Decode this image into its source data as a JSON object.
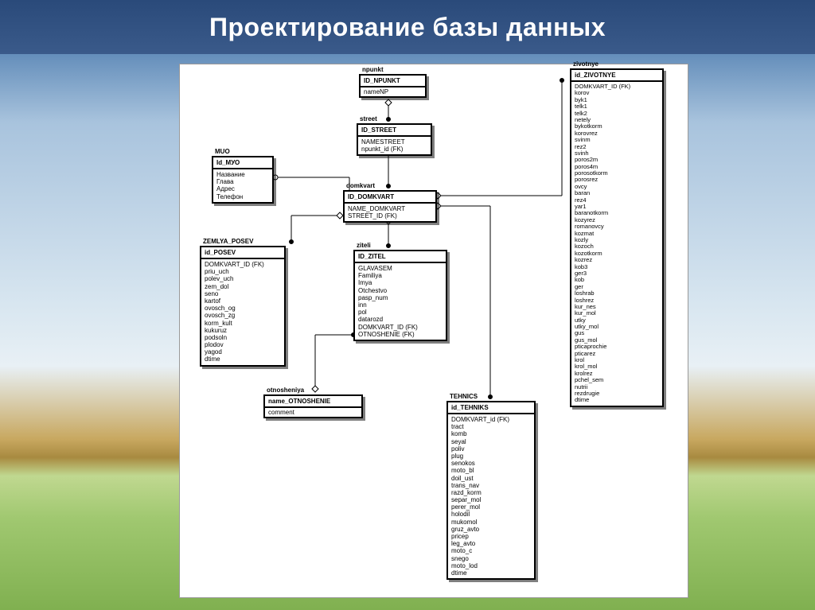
{
  "title": "Проектирование базы данных",
  "entities": {
    "npunkt": {
      "name": "npunkt",
      "key": "ID_NPUNKT",
      "attrs": [
        "nameNP"
      ]
    },
    "street": {
      "name": "street",
      "key": "ID_STREET",
      "attrs": [
        "NAMESTREET",
        "npunkt_id (FK)"
      ]
    },
    "muo": {
      "name": "MUO",
      "key": "Id_МУО",
      "attrs": [
        "Название",
        "Глава",
        "Адрес",
        "Телефон"
      ]
    },
    "domkvart": {
      "name": "domkvart",
      "key": "ID_DOMKVART",
      "attrs": [
        "NAME_DOMKVART",
        "STREET_ID (FK)"
      ]
    },
    "zemlya_posev": {
      "name": "ZEMLYA_POSEV",
      "key": "id_POSEV",
      "attrs": [
        "DOMKVART_ID (FK)",
        "priu_uch",
        "polev_uch",
        "zem_dol",
        "seno",
        "kartof",
        "ovosch_og",
        "ovosch_zg",
        "korm_kult",
        "kukuruz",
        "podsoln",
        "plodov",
        "yagod",
        "dtime"
      ]
    },
    "ziteli": {
      "name": "ziteli",
      "key": "ID_ZITEL",
      "attrs": [
        "GLAVASEM",
        "Familiya",
        "Imya",
        "Otchestvo",
        "pasp_num",
        "inn",
        "pol",
        "datarozd",
        "DOMKVART_ID (FK)",
        "OTNOSHENIE (FK)"
      ]
    },
    "otnosheniya": {
      "name": "otnosheniya",
      "key": "name_OTNOSHENIE",
      "attrs": [
        "comment"
      ]
    },
    "tehnics": {
      "name": "TEHNICS",
      "key": "id_TEHNIKS",
      "attrs": [
        "DOMKVART_id (FK)",
        "tract",
        "komb",
        "seyal",
        "poliv",
        "plug",
        "senokos",
        "moto_bl",
        "doil_ust",
        "trans_nav",
        "razd_korm",
        "separ_mol",
        "perer_mol",
        "holodil",
        "mukomol",
        "gruz_avto",
        "pricep",
        "leg_avto",
        "moto_c",
        "snego",
        "moto_lod",
        "dtime"
      ]
    },
    "zivotnye": {
      "name": "zivotnye",
      "key": "id_ZIVOTNYE",
      "attrs": [
        "DOMKVART_ID (FK)",
        "korov",
        "byk1",
        "telk1",
        "telk2",
        "netely",
        "bykotkorm",
        "korovrez",
        "svinm",
        "rez2",
        "svinh",
        "poros2m",
        "poros4m",
        "porosotkorm",
        "porosrez",
        "ovcy",
        "baran",
        "rez4",
        "yar1",
        "baranotkorm",
        "kozyrez",
        "romanovcy",
        "kozmat",
        "kozly",
        "kozoch",
        "kozotkorm",
        "kozrez",
        "kob3",
        "ger3",
        "kob",
        "ger",
        "loshrab",
        "loshrez",
        "kur_nes",
        "kur_mol",
        "utky",
        "utky_mol",
        "gus",
        "gus_mol",
        "pticaprochie",
        "pticarez",
        "krol",
        "krol_mol",
        "krolrez",
        "pchel_sem",
        "nutrii",
        "rezdrugie",
        "dtime"
      ]
    }
  }
}
